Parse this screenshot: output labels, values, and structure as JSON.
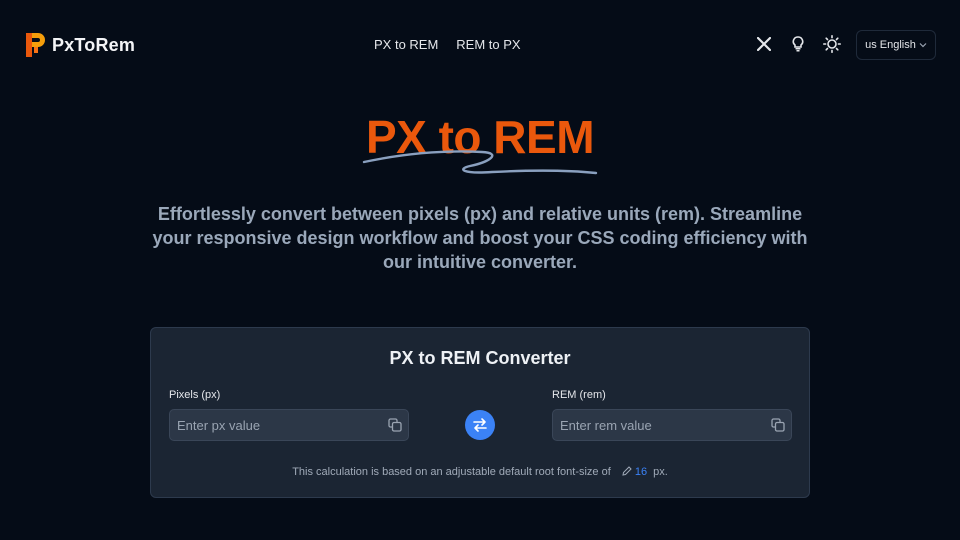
{
  "app": {
    "logo_text": "PxToRem"
  },
  "nav": {
    "items": [
      {
        "label": "PX to REM"
      },
      {
        "label": "REM to PX"
      }
    ]
  },
  "header": {
    "icons": [
      "x-twitter-icon",
      "lightbulb-icon",
      "sun-icon"
    ],
    "language": {
      "flag": "us",
      "label": "English"
    }
  },
  "hero": {
    "title": "PX to REM",
    "subtitle": "Effortlessly convert between pixels (px) and relative units (rem). Streamline your responsive design workflow and boost your CSS coding efficiency with our intuitive converter."
  },
  "converter": {
    "title": "PX to REM Converter",
    "px_label": "Pixels (px)",
    "px_placeholder": "Enter px value",
    "rem_label": "REM (rem)",
    "rem_placeholder": "Enter rem value",
    "note_text": "This calculation is based on an adjustable default root font-size of",
    "root_font_size": "16",
    "unit": "px."
  },
  "colors": {
    "background": "#050c17",
    "accent": "#ea580c",
    "primary": "#3b82f6",
    "card": "#1b2533"
  }
}
